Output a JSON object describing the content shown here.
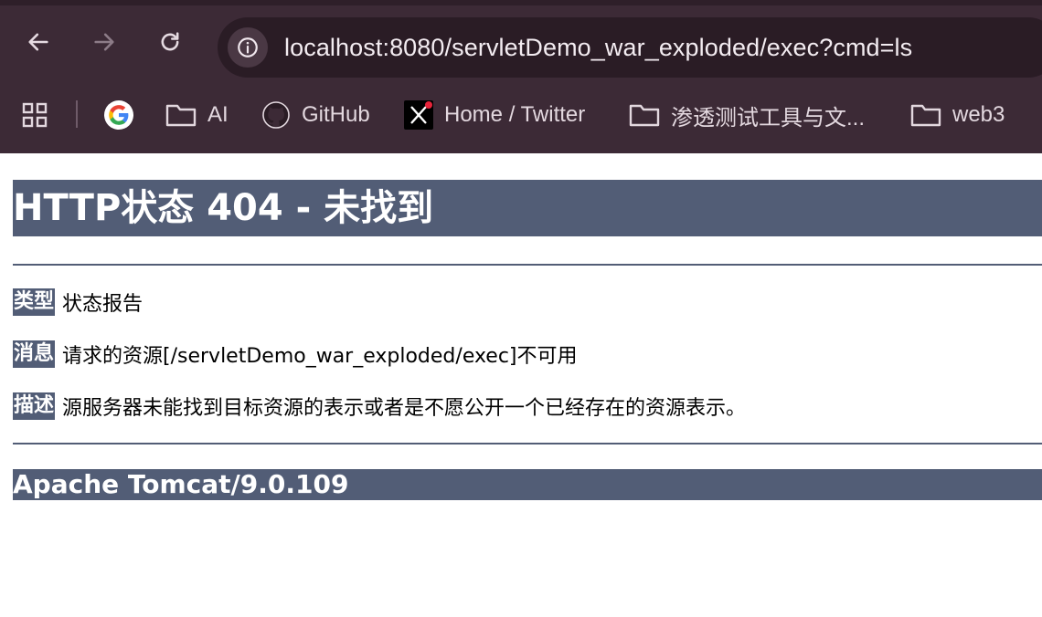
{
  "browser": {
    "url": "localhost:8080/servletDemo_war_exploded/exec?cmd=ls",
    "nav": {
      "back_icon": "arrow-left-icon",
      "forward_icon": "arrow-right-icon",
      "reload_icon": "reload-icon",
      "info_icon": "info-icon"
    },
    "bookmarks": [
      {
        "label": "",
        "icon": "google-icon"
      },
      {
        "label": "AI",
        "icon": "folder-icon"
      },
      {
        "label": "GitHub",
        "icon": "github-icon"
      },
      {
        "label": "Home / Twitter",
        "icon": "x-icon"
      },
      {
        "label": "渗透测试工具与文...",
        "icon": "folder-icon"
      },
      {
        "label": "web3",
        "icon": "folder-icon"
      }
    ]
  },
  "page": {
    "title": "HTTP状态 404 - 未找到",
    "type_label": "类型",
    "type_value": "状态报告",
    "message_label": "消息",
    "message_value": "请求的资源[/servletDemo_war_exploded/exec]不可用",
    "description_label": "描述",
    "description_value": "源服务器未能找到目标资源的表示或者是不愿公开一个已经存在的资源表示。",
    "footer": "Apache Tomcat/9.0.109"
  },
  "colors": {
    "chrome_bg": "#3c2a36",
    "tomcat_header": "#525d76"
  }
}
